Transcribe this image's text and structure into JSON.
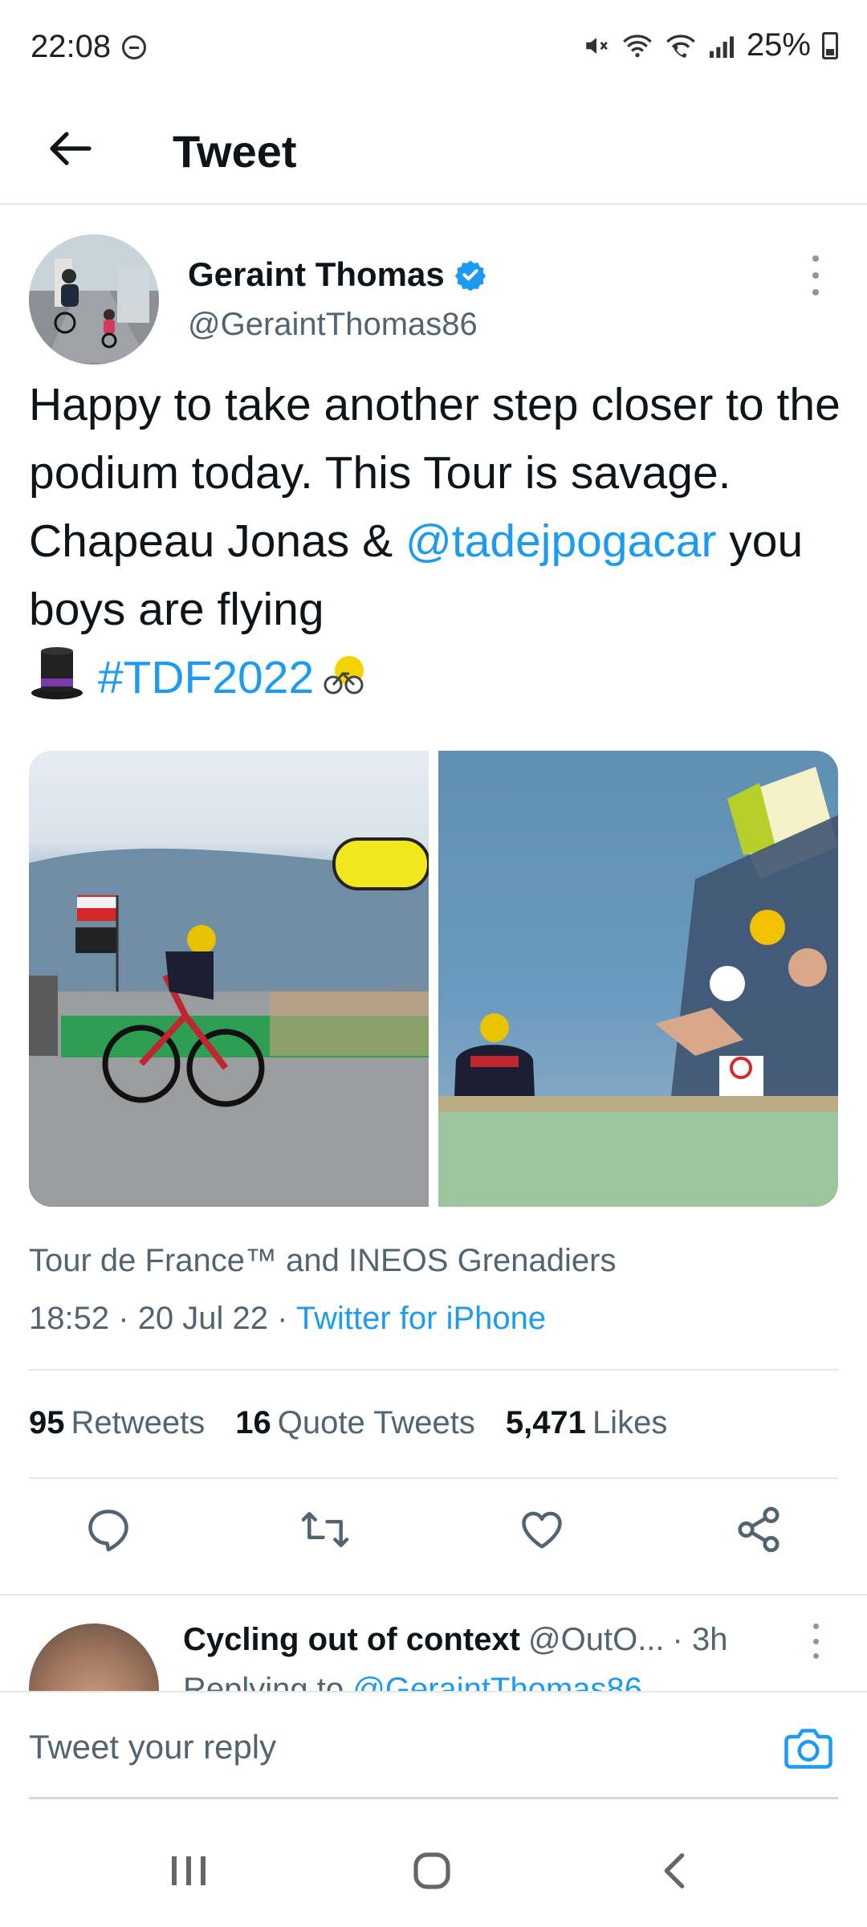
{
  "status_bar": {
    "time": "22:08",
    "battery": "25%",
    "icons": [
      "do-not-disturb-icon",
      "mute-icon",
      "wifi-icon",
      "wifi-calling-icon",
      "signal-icon",
      "battery-icon"
    ]
  },
  "header": {
    "title": "Tweet",
    "back_icon": "arrow-left-icon"
  },
  "tweet": {
    "author_name": "Geraint Thomas",
    "author_handle": "@GeraintThomas86",
    "text_part1": "Happy to take another step closer to the podium today. This Tour is savage. Chapeau Jonas & ",
    "mention": "@tadejpogacar",
    "text_part2": " you boys are flying ",
    "hashtag": "#TDF2022",
    "emojis": [
      "top-hat-emoji",
      "tdf-bike-emoji"
    ],
    "media": [
      "cyclist-finish-line-photo",
      "cyclist-crowd-photo"
    ],
    "tagged": "Tour de France™ and INEOS Grenadiers",
    "time": "18:52",
    "date": "20 Jul 22",
    "separator": "·",
    "client": "Twitter for iPhone",
    "retweets_count": "95",
    "retweets_label": "Retweets",
    "quotes_count": "16",
    "quotes_label": "Quote Tweets",
    "likes_count": "5,471",
    "likes_label": "Likes"
  },
  "actions": [
    "reply-icon",
    "retweet-icon",
    "like-icon",
    "share-icon"
  ],
  "reply_preview": {
    "name": "Cycling out of context",
    "handle": "@OutO...",
    "time": "· 3h",
    "replying_prefix": "Replying to ",
    "replying_to": "@GeraintThomas86"
  },
  "composer": {
    "placeholder": "Tweet your reply"
  },
  "colors": {
    "link": "#1d9bf0",
    "secondary_text": "#536471",
    "primary_text": "#0f1419"
  }
}
